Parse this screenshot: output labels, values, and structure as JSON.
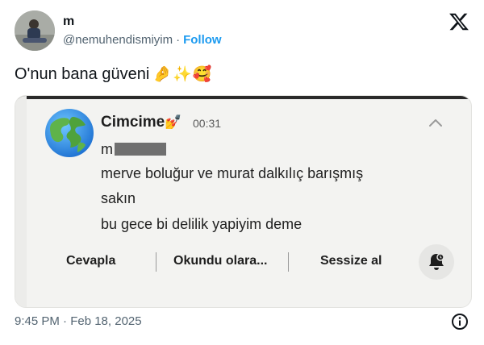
{
  "author": {
    "name": "m",
    "handle": "@nemuhendismiyim",
    "separator": "·",
    "follow_label": "Follow"
  },
  "tweet": {
    "text": "O'nun bana güveni",
    "emojis": "🤌✨🥰",
    "timestamp": "9:45 PM · Feb 18, 2025"
  },
  "notification": {
    "sender": "Cimcime",
    "sender_emoji": "💅",
    "time": "00:31",
    "lines": [
      "m",
      "merve boluğur ve murat dalkılıç barışmış",
      "sakın",
      "bu gece bi delilik yapiyim deme"
    ],
    "actions": {
      "reply": "Cevapla",
      "mark_read": "Okundu olara...",
      "mute": "Sessize al"
    }
  },
  "icons": {
    "brand": "x-logo-icon",
    "info": "info-icon",
    "app": "globe-icon",
    "collapse": "chevron-up-icon",
    "mute": "bell-snooze-icon"
  },
  "colors": {
    "link": "#1d9bf0",
    "secondary_text": "#536471",
    "primary_text": "#0f1419"
  }
}
